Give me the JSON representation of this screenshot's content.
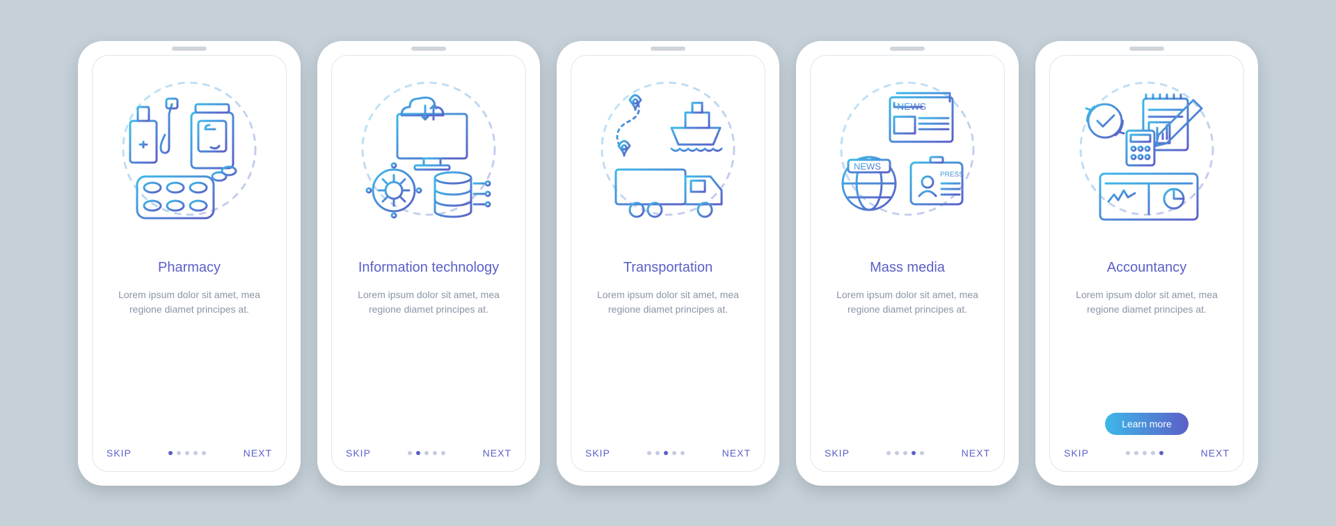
{
  "screens": [
    {
      "title": "Pharmacy",
      "description": "Lorem ipsum dolor sit amet, mea regione diamet principes at.",
      "icon": "pharmacy-icon",
      "showLearnMore": false
    },
    {
      "title": "Information technology",
      "description": "Lorem ipsum dolor sit amet, mea regione diamet principes at.",
      "icon": "it-icon",
      "showLearnMore": false
    },
    {
      "title": "Transportation",
      "description": "Lorem ipsum dolor sit amet, mea regione diamet principes at.",
      "icon": "transportation-icon",
      "showLearnMore": false
    },
    {
      "title": "Mass media",
      "description": "Lorem ipsum dolor sit amet, mea regione diamet principes at.",
      "icon": "media-icon",
      "showLearnMore": false
    },
    {
      "title": "Accountancy",
      "description": "Lorem ipsum dolor sit amet, mea regione diamet principes at.",
      "icon": "accountancy-icon",
      "showLearnMore": true
    }
  ],
  "nav": {
    "skip": "SKIP",
    "next": "NEXT",
    "dotsCount": 5,
    "learnMore": "Learn more"
  }
}
